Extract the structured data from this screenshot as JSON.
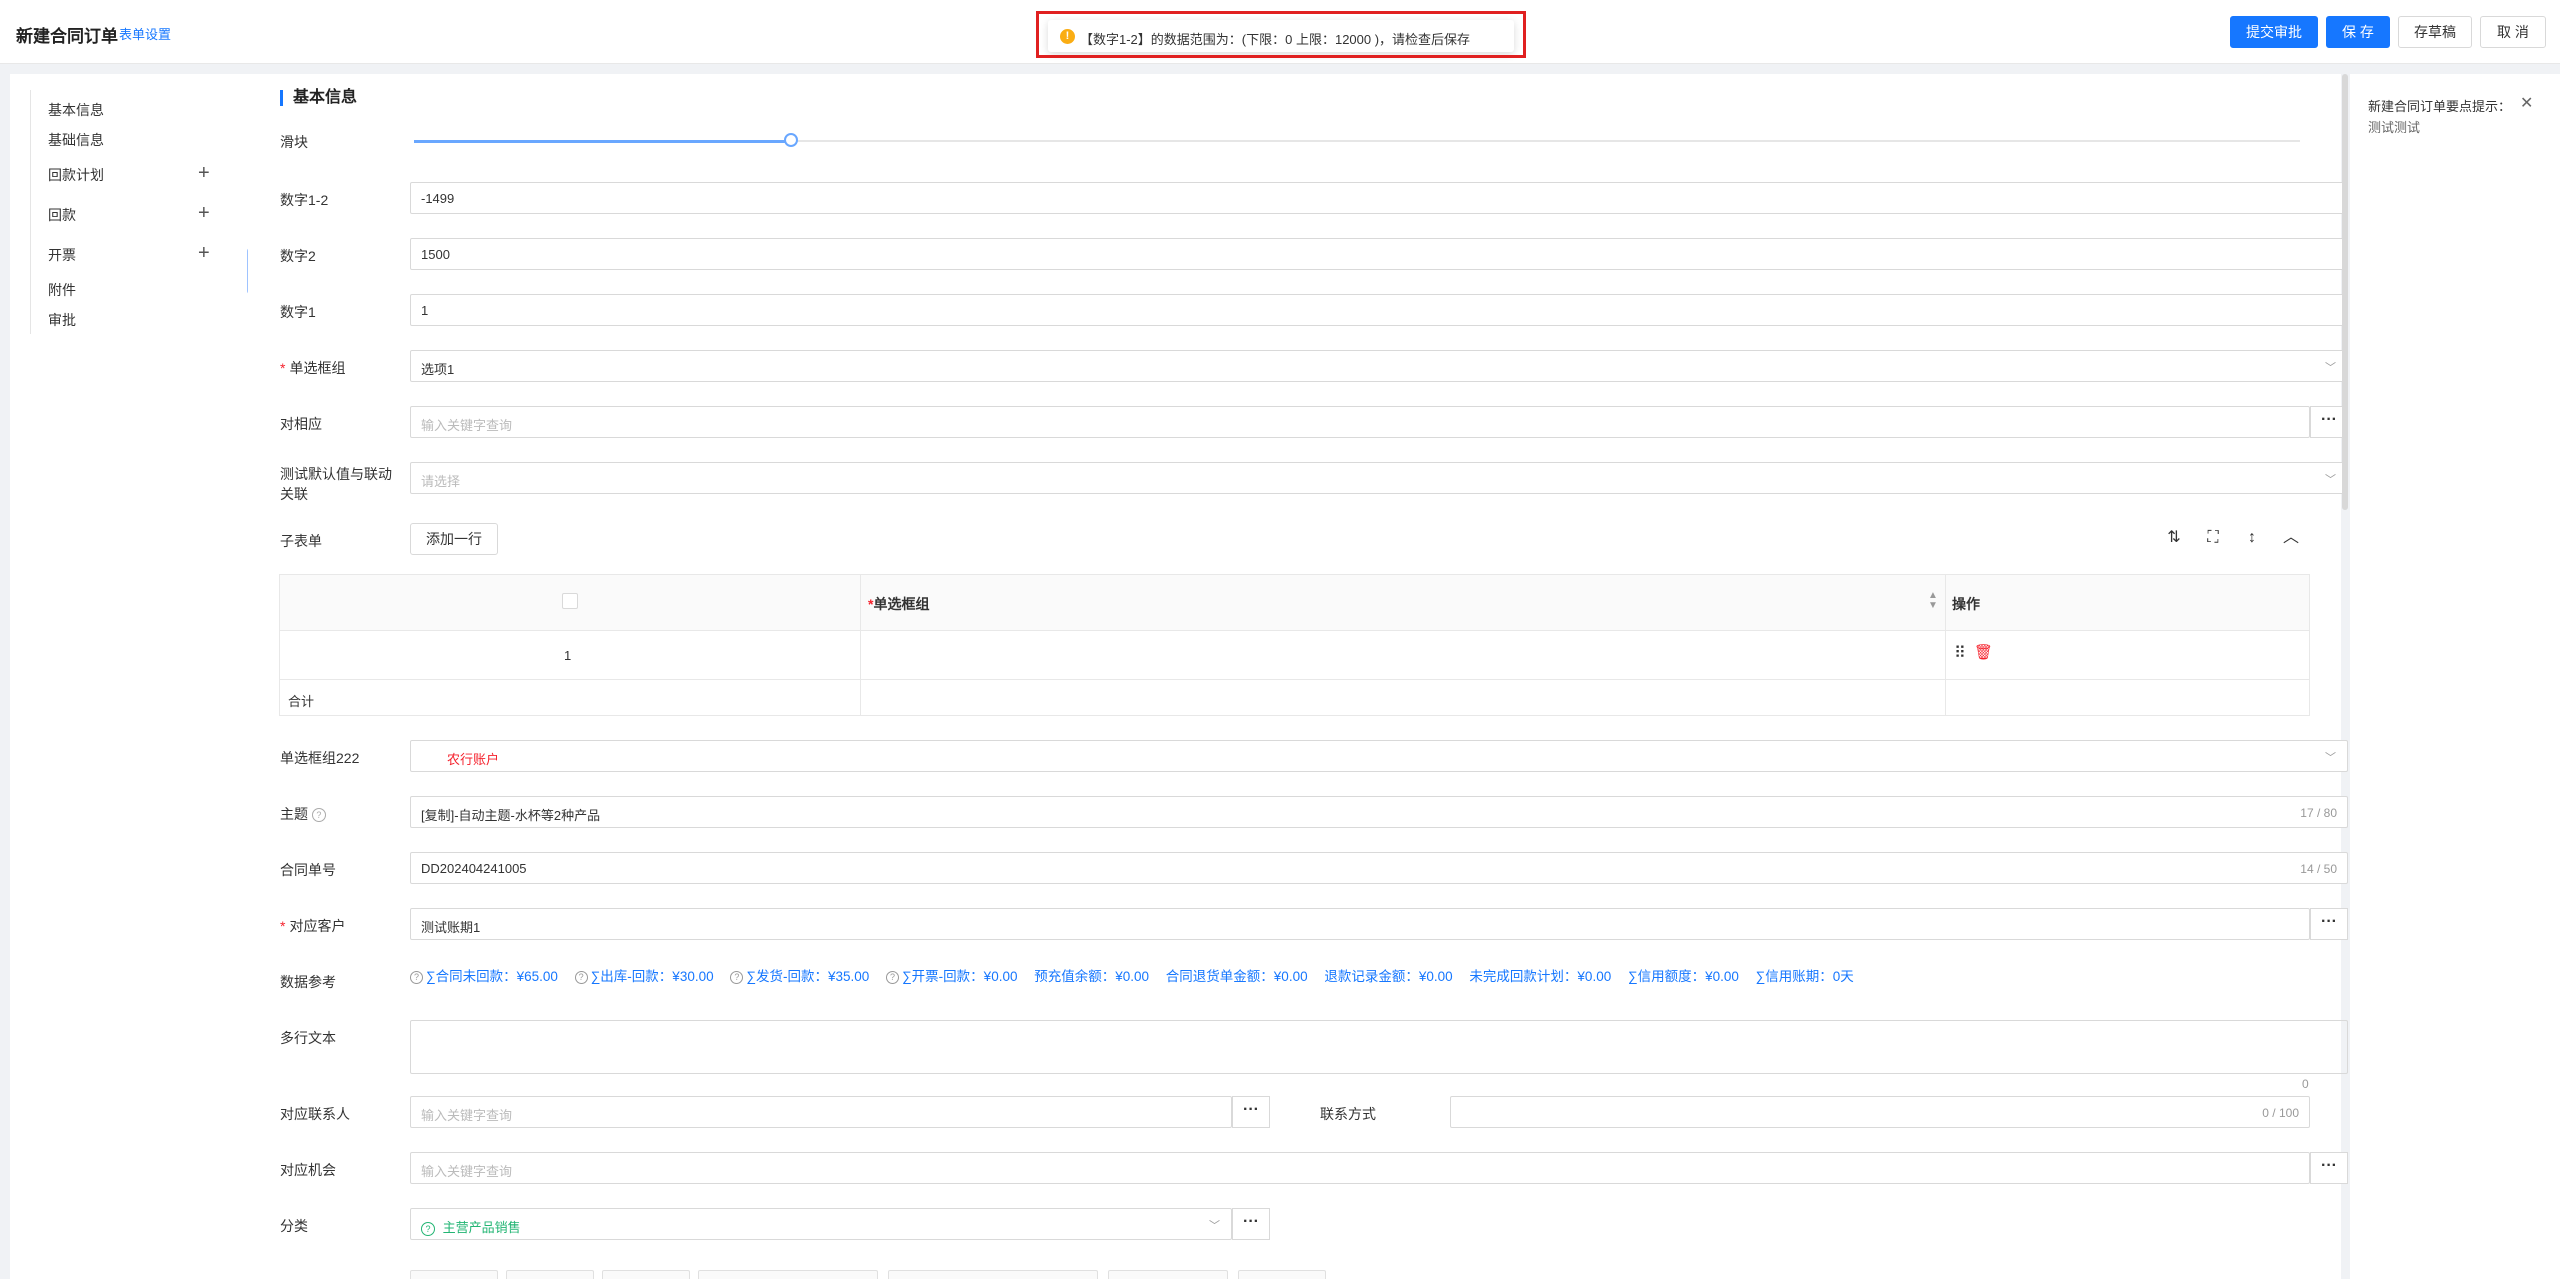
{
  "header": {
    "title": "新建合同订单",
    "form_settings": "表单设置",
    "submit_approval": "提交审批",
    "save": "保 存",
    "save_draft": "存草稿",
    "cancel": "取 消"
  },
  "toast": {
    "message": "【数字1-2】的数据范围为：(下限：0 上限：12000 )，请检查后保存",
    "icon": "!"
  },
  "nav": {
    "items": [
      {
        "label": "基本信息"
      },
      {
        "label": "基础信息"
      },
      {
        "label": "回款计划"
      },
      {
        "label": "回款"
      },
      {
        "label": "开票"
      },
      {
        "label": "附件"
      },
      {
        "label": "审批"
      }
    ],
    "plus": "+",
    "collapse": "‹"
  },
  "form": {
    "section_title": "基本信息",
    "slider": {
      "label": "滑块",
      "value_fraction": 0.2
    },
    "num12": {
      "label": "数字1-2",
      "value": "-1499"
    },
    "num2": {
      "label": "数字2",
      "value": "1500"
    },
    "num1": {
      "label": "数字1",
      "value": "1"
    },
    "radio_group": {
      "label": "单选框组",
      "value": "选项1"
    },
    "corresponding": {
      "label": "对相应",
      "placeholder": "输入关键字查询"
    },
    "default_link": {
      "label_line1": "测试默认值与联动",
      "label_line2": "关联",
      "placeholder": "请选择"
    },
    "subform": {
      "label": "子表单",
      "add_row": "添加一行",
      "col_radio": "单选框组",
      "col_ops": "操作",
      "row_index": "1",
      "total": "合计"
    },
    "radio222": {
      "label": "单选框组222",
      "value": "农行账户"
    },
    "subject": {
      "label": "主题",
      "value": "[复制]-自动主题-水杯等2种产品",
      "counter": "17 / 80"
    },
    "contract_no": {
      "label": "合同单号",
      "value": "DD202404241005",
      "counter": "14 / 50"
    },
    "customer": {
      "label": "对应客户",
      "value": "测试账期1"
    },
    "data_ref": {
      "label": "数据参考",
      "items": [
        "∑合同未回款：¥65.00",
        "∑出库-回款：¥30.00",
        "∑发货-回款：¥35.00",
        "∑开票-回款：¥0.00",
        "预充值余额：¥0.00",
        "合同退货单金额：¥0.00",
        "退款记录金额：¥0.00",
        "未完成回款计划：¥0.00",
        "∑信用额度：¥0.00",
        "∑信用账期：0天"
      ]
    },
    "multiline": {
      "label": "多行文本",
      "counter": "0"
    },
    "contact": {
      "label": "对应联系人",
      "placeholder": "输入关键字查询"
    },
    "contact_method": {
      "label": "联系方式",
      "counter": "0 / 100"
    },
    "opportunity": {
      "label": "对应机会",
      "placeholder": "输入关键字查询"
    },
    "category": {
      "label": "分类",
      "value": "主营产品销售"
    }
  },
  "right_tip": {
    "title": "新建合同订单要点提示：",
    "body": "测试测试",
    "close": "✕"
  },
  "colors": {
    "primary": "#1677ff",
    "warning": "#faad14",
    "danger": "#f5222d",
    "green_tag": "#22b573"
  }
}
